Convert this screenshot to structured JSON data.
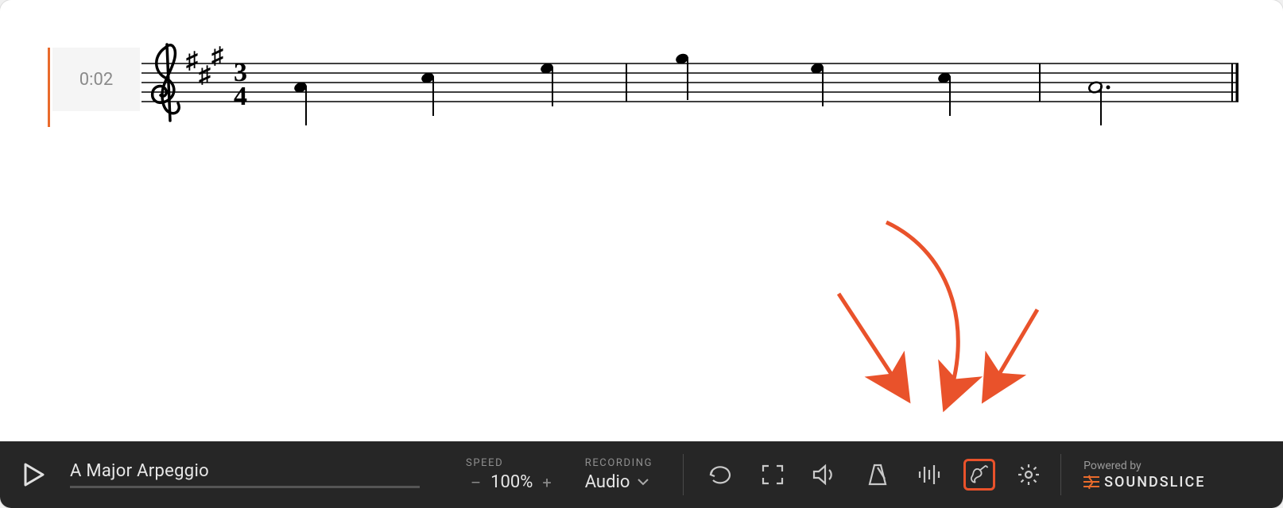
{
  "playhead_time": "0:02",
  "title": "A Major Arpeggio",
  "speed": {
    "label": "SPEED",
    "value": "100%"
  },
  "recording": {
    "label": "RECORDING",
    "value": "Audio"
  },
  "powered": {
    "label": "Powered by",
    "brand": "SOUNDSLICE"
  },
  "notation": {
    "clef": "treble",
    "key_signature": "A major (3 sharps)",
    "time_signature": "3/4",
    "measures": [
      {
        "notes": [
          "A4 quarter",
          "C#5 quarter",
          "E5 quarter"
        ]
      },
      {
        "notes": [
          "A5 quarter",
          "E5 quarter",
          "C#5 quarter"
        ]
      },
      {
        "notes": [
          "A4 dotted-half"
        ]
      }
    ]
  },
  "icons": {
    "loop": "loop-icon",
    "fullscreen": "fullscreen-icon",
    "volume": "volume-icon",
    "metronome": "metronome-icon",
    "waveform": "waveform-icon",
    "instrument": "instrument-icon",
    "settings": "settings-icon"
  },
  "annotation": {
    "highlight_target": "instrument-icon",
    "arrows": 3
  }
}
